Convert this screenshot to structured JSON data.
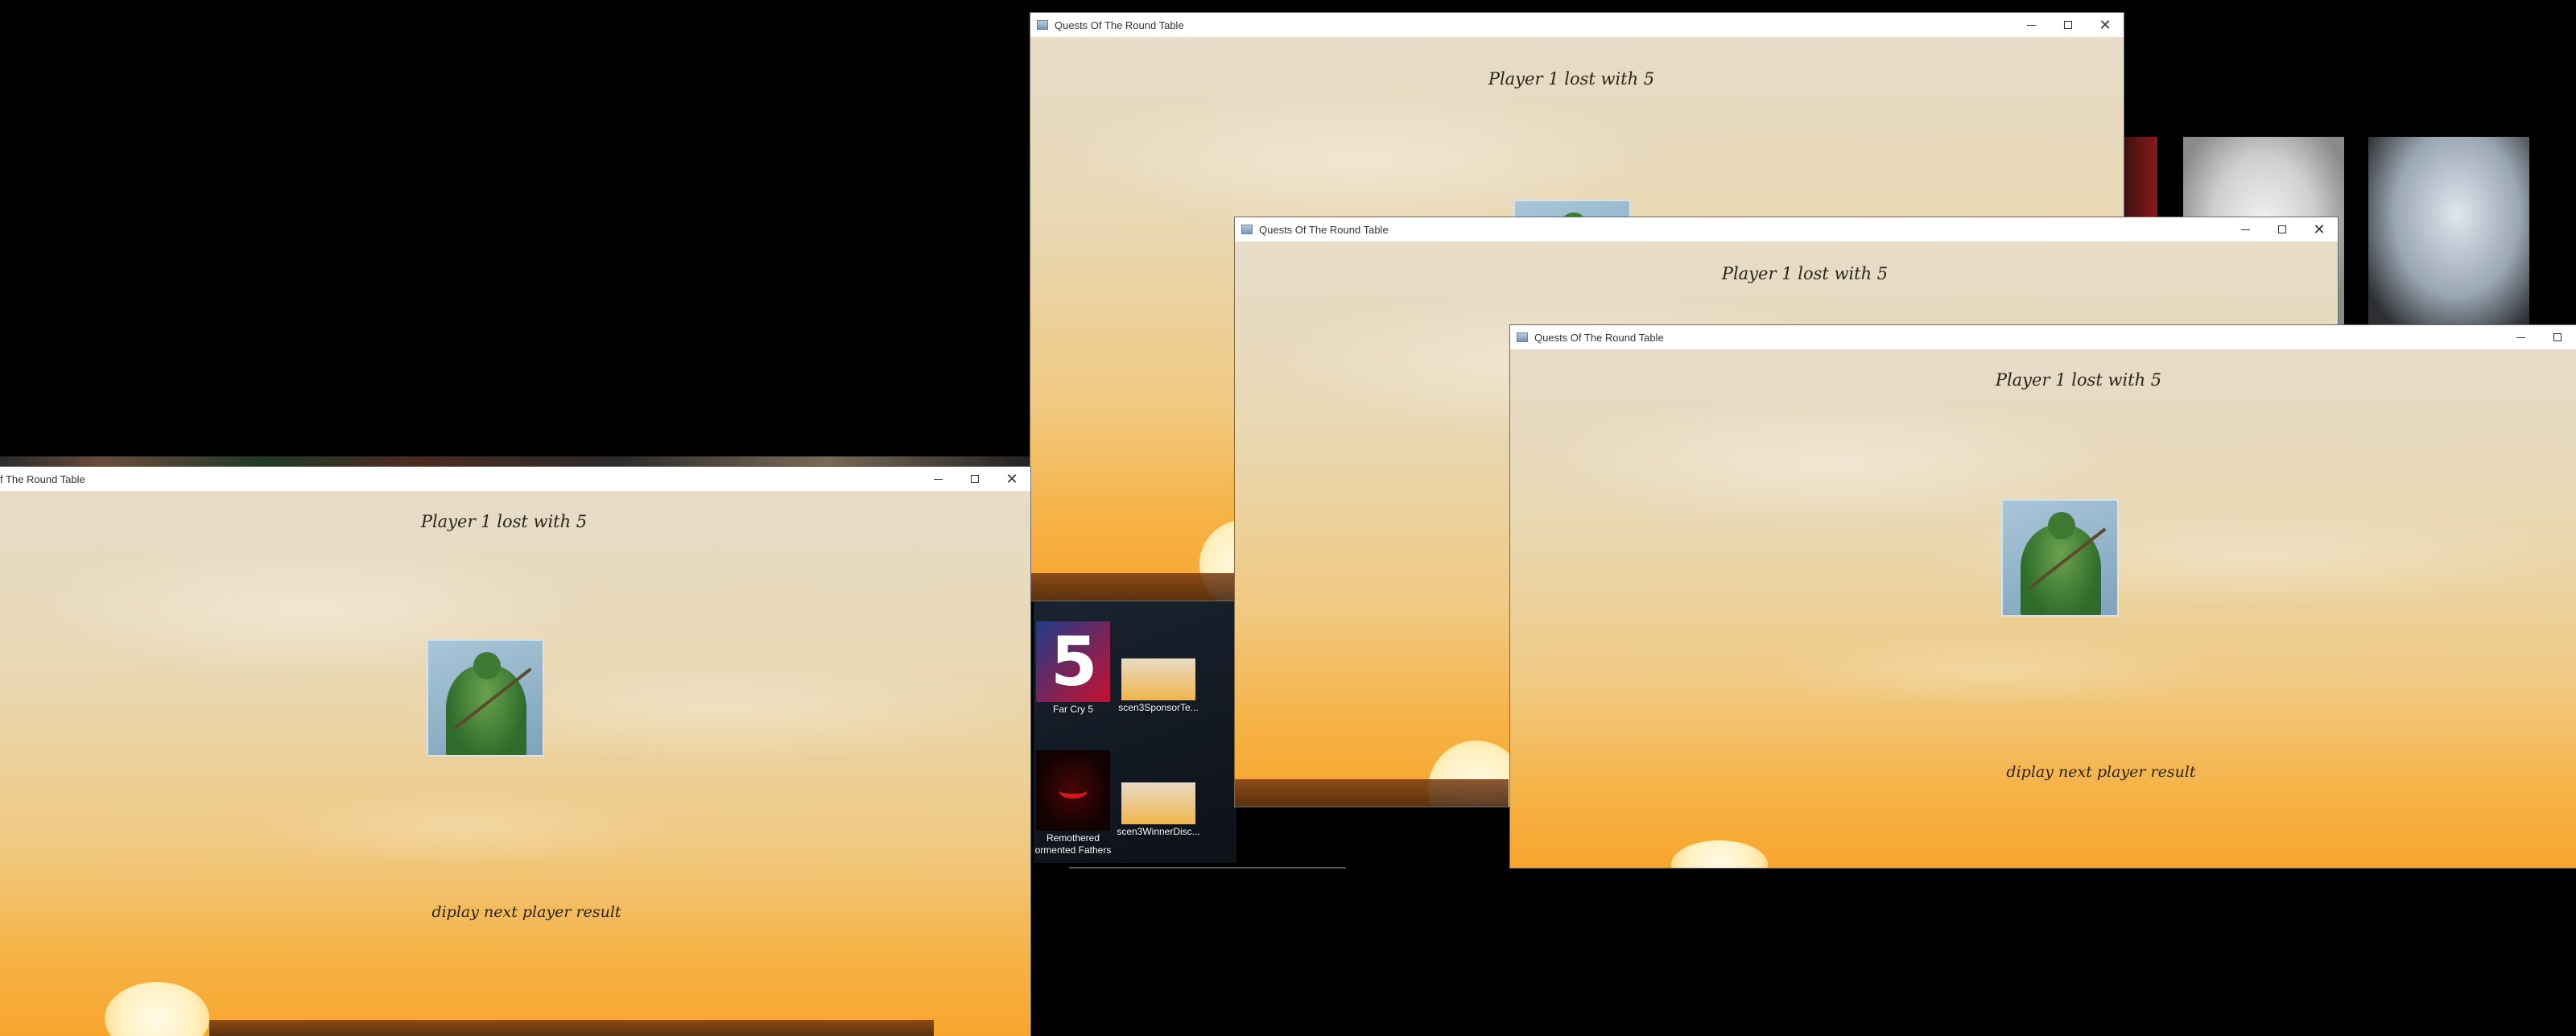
{
  "windows": {
    "title": "Quests Of The Round Table",
    "title_cut": "f The Round Table",
    "status_message": "Player 1 lost with 5",
    "sub_message": "diplay next player result"
  },
  "desktop": {
    "icons": [
      {
        "label": "Far Cry 5",
        "icon": "far-cry-5-icon",
        "badge": "5"
      },
      {
        "label": "scen3SponsorTe...",
        "icon": "image-thumbnail-icon"
      },
      {
        "label": "Remothered\nTormented Fathers",
        "label_line1": "Remothered",
        "label_line2": "ormented Fathers",
        "icon": "red-wings-icon"
      },
      {
        "label": "scen3WinnerDisc...",
        "icon": "image-thumbnail-icon"
      }
    ]
  },
  "colors": {
    "sky_top": "#e6dcc9",
    "sky_bottom": "#f8a52d",
    "desktop": "#000000",
    "text": "#2b2418"
  }
}
